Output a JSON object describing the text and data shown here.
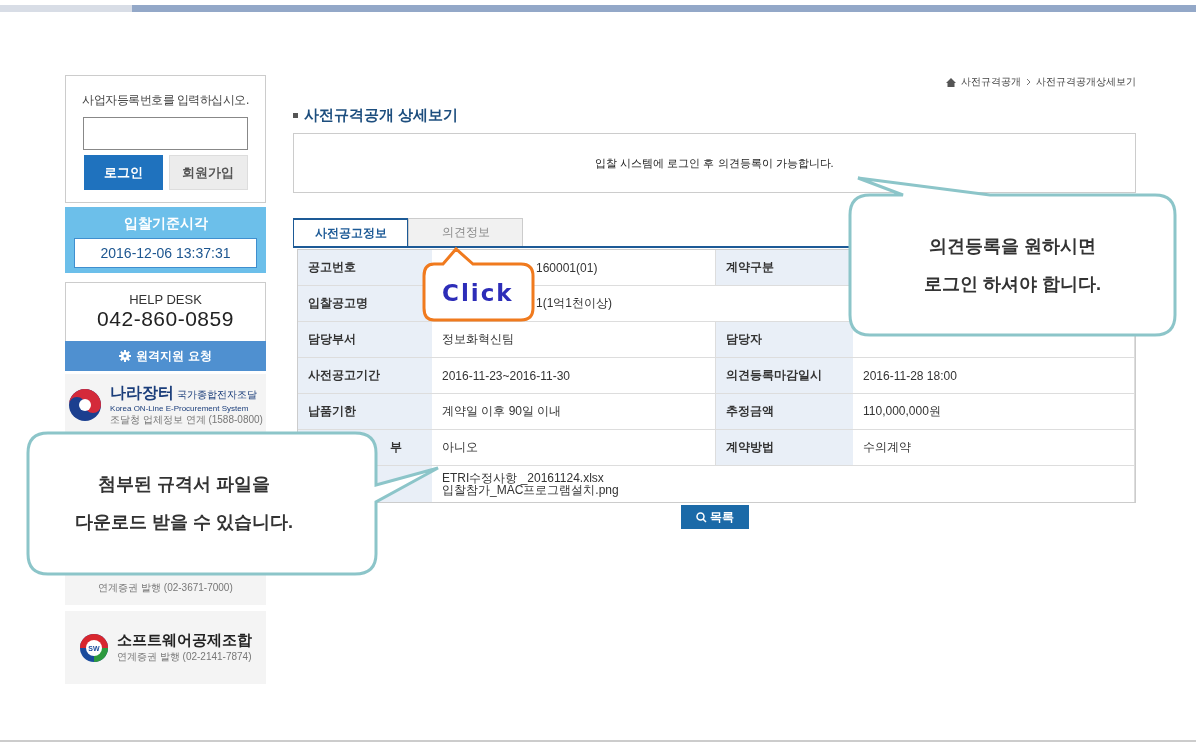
{
  "sidebar": {
    "login": {
      "prompt": "사업자등록번호를 입력하십시오.",
      "login_button": "로그인",
      "join_button": "회원가입"
    },
    "clock": {
      "title": "입찰기준시각",
      "time": "2016-12-06 13:37:31"
    },
    "help_desk": {
      "title": "HELP DESK",
      "phone": "042-860-0859",
      "remote_button": "원격지원 요청"
    },
    "partners": [
      {
        "kind": "nara",
        "name": "나라장터",
        "subtitle": "국가종합전자조달",
        "english": "Korea ON-Line E-Procurement System",
        "note": "조달청 업체정보 연계 (1588-0800)"
      },
      {
        "kind": "hidden",
        "note": "연계증권 발행 (02-3671-7000)"
      },
      {
        "kind": "sw",
        "badge": "SW",
        "name": "소프트웨어공제조합",
        "note": "연계증권 발행 (02-2141-7874)"
      }
    ]
  },
  "breadcrumb": [
    "사전규격공개",
    "사전규격공개상세보기"
  ],
  "title": "사전규격공개 상세보기",
  "notice": "입찰 시스템에 로그인 후 의견등록이 가능합니다.",
  "tabs": [
    {
      "label": "사전공고정보",
      "selected": true
    },
    {
      "label": "의견정보",
      "selected": false
    }
  ],
  "table": {
    "rows": [
      [
        {
          "label": "공고번호",
          "value": "160001(01)",
          "partial_value": true
        },
        {
          "label": "계약구분"
        }
      ],
      [
        {
          "label": "입찰공고명",
          "value": "1(1억1천이상)",
          "partial_value": true
        }
      ],
      [
        {
          "label": "담당부서",
          "value": "정보화혁신팀"
        },
        {
          "label": "담당자"
        }
      ],
      [
        {
          "label": "사전공고기간",
          "value": "2016-11-23~2016-11-30"
        },
        {
          "label": "의견등록마감일시",
          "value": "2016-11-28 18:00"
        }
      ],
      [
        {
          "label": "납품기한",
          "value": "계약일 이후 90일 이내"
        },
        {
          "label": "추정금액",
          "value": "110,000,000원"
        }
      ],
      [
        {
          "label": "부",
          "value": "아니오",
          "partial_label": true
        },
        {
          "label": "계약방법",
          "value": "수의계약"
        }
      ],
      [
        {
          "files": [
            "ETRI수정사항 _20161124.xlsx",
            "입찰참가_MAC프로그램설치.png"
          ]
        }
      ]
    ]
  },
  "list_button": "목록",
  "callouts": [
    {
      "kind": "right",
      "text": "의견등록을 원하시면\n로그인 하셔야 합니다."
    },
    {
      "kind": "left",
      "text": "첨부된 규격서 파일을\n다운로드 받을 수 있습니다."
    },
    {
      "kind": "click",
      "text": "Click"
    }
  ]
}
